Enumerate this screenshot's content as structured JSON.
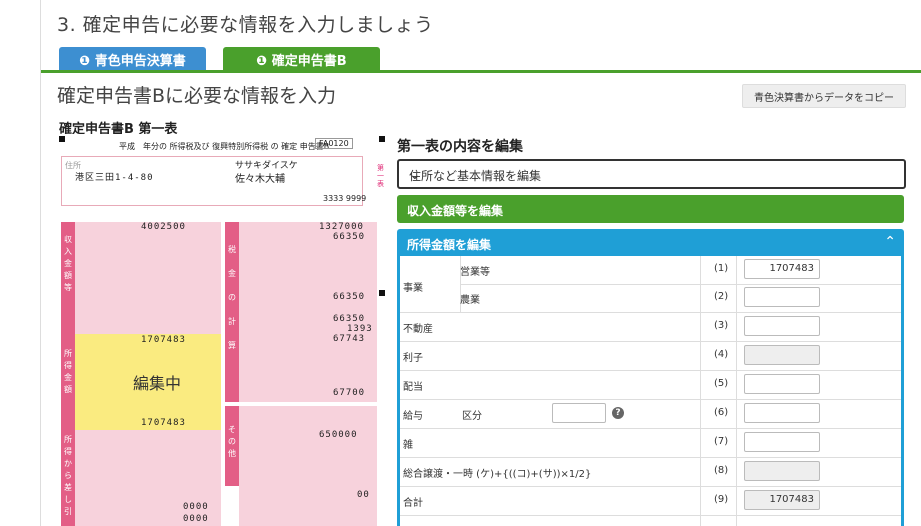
{
  "step_title": "3. 確定申告に必要な情報を入力しましょう",
  "tabs": [
    {
      "label": "❶ 青色申告決算書",
      "color": "#3d8fd1"
    },
    {
      "label": "❶ 確定申告書B",
      "color": "#4aa02c"
    }
  ],
  "section_title": "確定申告書Bに必要な情報を入力",
  "copy_button": "青色決算書からデータをコピー",
  "form_subtitle": "確定申告書B 第一表",
  "form_image": {
    "header_text": "平成　年分の 所得税及び 復興特別所得税 の 確定 申告書B",
    "form_code": "FA0120",
    "address": "港区三田1-4-80",
    "furigana": "ササキダイスケ",
    "name": "佐々木大輔",
    "phone": "3333 9999",
    "income_values": [
      "4002500",
      "1707483",
      "1707483"
    ],
    "tax_values": [
      "1327000",
      "66350",
      "66350",
      "66350",
      "1393",
      "67743",
      "67700",
      "650000",
      "00",
      "0000",
      "0000"
    ],
    "editing_label": "編集中",
    "side_labels": [
      "収入金額等",
      "所得金額",
      "所得から差し引かれる",
      "税金の計算",
      "その他"
    ]
  },
  "right_panel": {
    "title": "第一表の内容を編集",
    "accordions": {
      "basic": "住所など基本情報を編集",
      "income": "収入金額等を編集",
      "shotoku": "所得金額を編集"
    },
    "rows": [
      {
        "group": "事業",
        "label": "営業等",
        "num": "(1)",
        "value": "1707483",
        "disabled": false
      },
      {
        "group": "",
        "label": "農業",
        "num": "(2)",
        "value": "",
        "disabled": false
      },
      {
        "group": "不動産",
        "label": "",
        "num": "(3)",
        "value": "",
        "disabled": false
      },
      {
        "group": "利子",
        "label": "",
        "num": "(4)",
        "value": "",
        "disabled": true
      },
      {
        "group": "配当",
        "label": "",
        "num": "(5)",
        "value": "",
        "disabled": false
      },
      {
        "group": "給与",
        "label": "区分",
        "num": "(6)",
        "value": "",
        "disabled": false
      },
      {
        "group": "雑",
        "label": "",
        "num": "(7)",
        "value": "",
        "disabled": false
      },
      {
        "group": "総合譲渡・一時 (ケ)+{((コ)+(サ))×1/2}",
        "label": "",
        "num": "(8)",
        "value": "",
        "disabled": true
      },
      {
        "group": "合計",
        "label": "",
        "num": "(9)",
        "value": "1707483",
        "disabled": true
      }
    ],
    "help_icon": "question-circle-icon"
  }
}
